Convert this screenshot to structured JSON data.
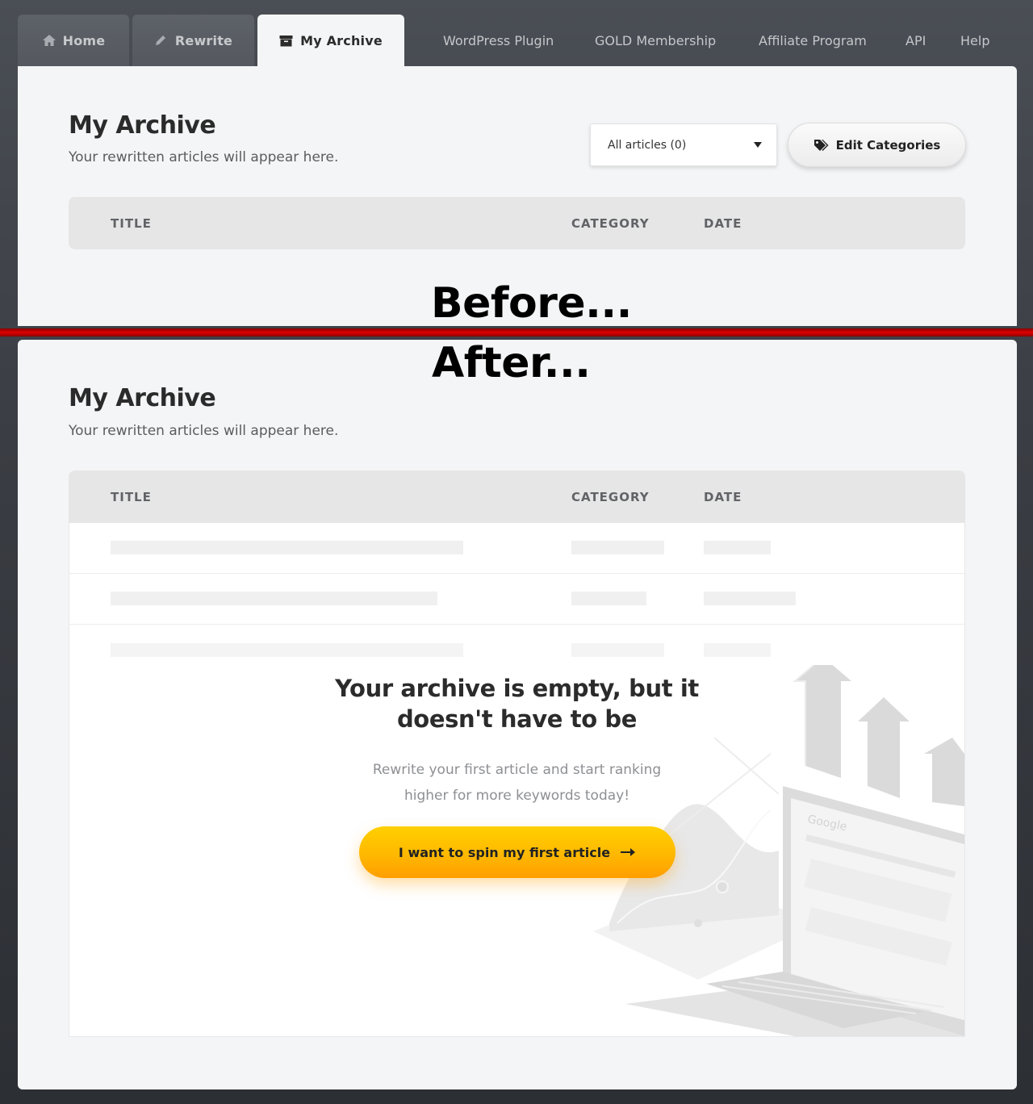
{
  "tabs": [
    {
      "label": "Home",
      "icon": "home-icon",
      "active": false
    },
    {
      "label": "Rewrite",
      "icon": "pencil-icon",
      "active": false
    },
    {
      "label": "My Archive",
      "icon": "archive-box-icon",
      "active": true
    }
  ],
  "nav_links": [
    "WordPress Plugin",
    "GOLD Membership",
    "Affiliate Program",
    "API",
    "Help"
  ],
  "overlay_labels": {
    "before": "Before...",
    "after": "After..."
  },
  "before_panel": {
    "title": "My Archive",
    "subtitle": "Your rewritten articles will appear here.",
    "filter_select": {
      "selected": "All articles (0)"
    },
    "edit_categories_label": "Edit Categories",
    "table_headers": {
      "title": "TITLE",
      "category": "CATEGORY",
      "date": "DATE"
    }
  },
  "after_panel": {
    "title": "My Archive",
    "subtitle": "Your rewritten articles will appear here.",
    "table_headers": {
      "title": "TITLE",
      "category": "CATEGORY",
      "date": "DATE"
    },
    "empty_state": {
      "heading_line1": "Your archive is empty, but it",
      "heading_line2": "doesn't have to be",
      "text_line1": "Rewrite your first article and start ranking",
      "text_line2": "higher for more keywords today!",
      "cta_label": "I want to spin my first article",
      "illustration_search_logo": "Google"
    }
  },
  "colors": {
    "background": "#3a3d43",
    "panel": "#f4f5f6",
    "divider": "#d40000",
    "cta_yellow": "#ffc400",
    "cta_orange": "#ff9e00"
  }
}
